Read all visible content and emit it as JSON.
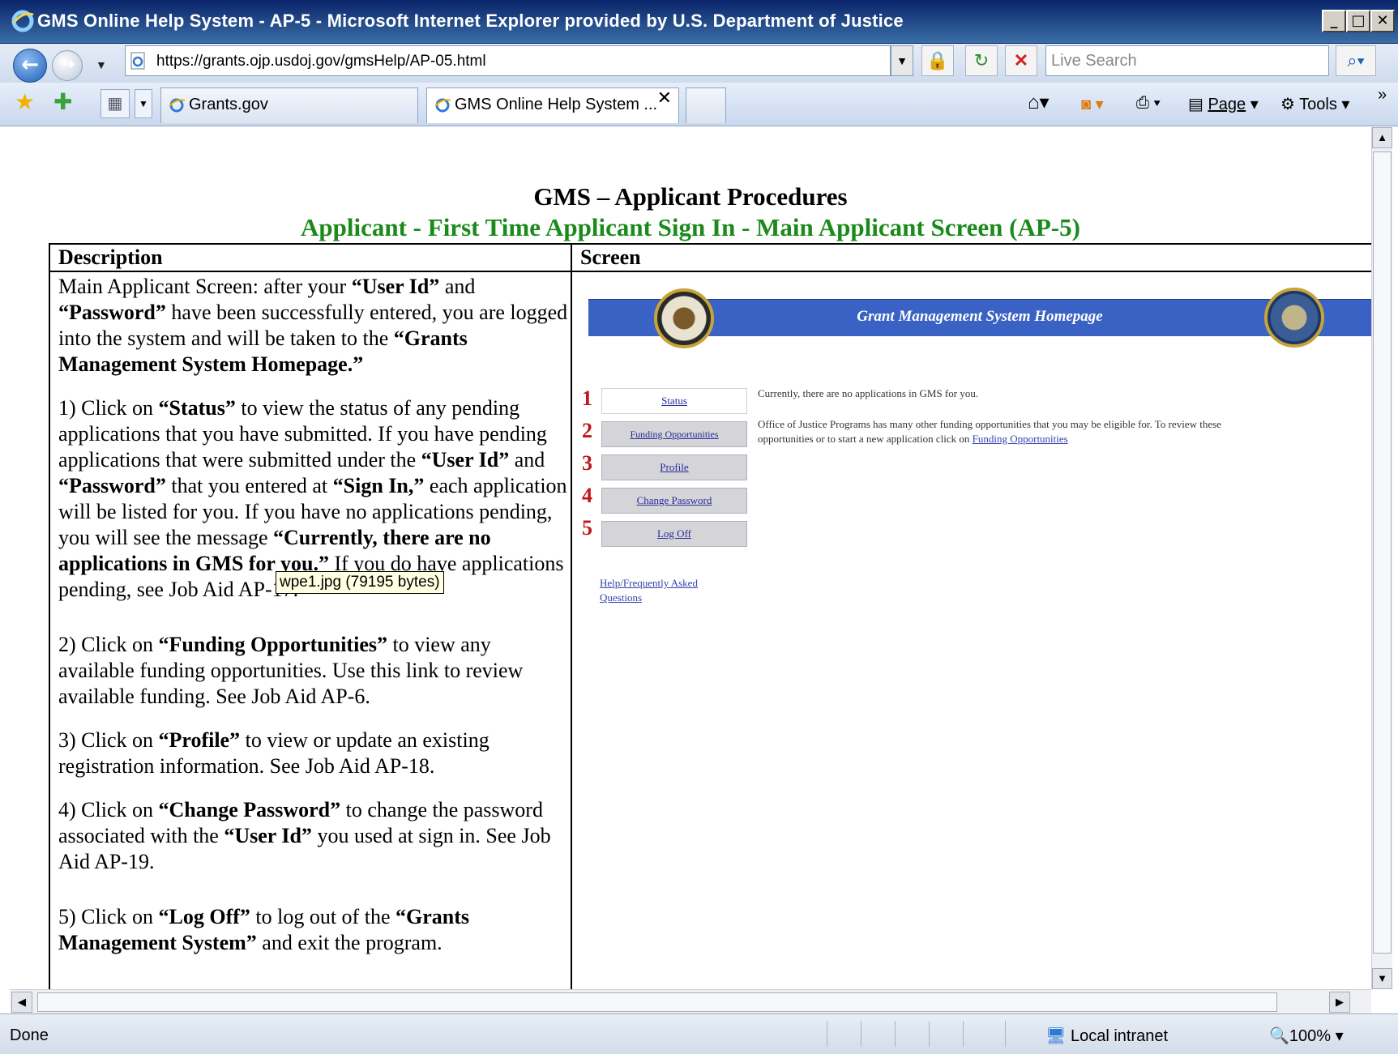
{
  "window": {
    "title": "GMS Online Help System - AP-5 - Microsoft Internet Explorer provided by U.S. Department of Justice",
    "controls": [
      "_",
      "□",
      "✕"
    ]
  },
  "address_bar": {
    "url": "https://grants.ojp.usdoj.gov/gmsHelp/AP-05.html",
    "search_placeholder": "Live Search"
  },
  "tabs": [
    {
      "label": "Grants.gov",
      "active": false
    },
    {
      "label": "GMS Online Help System ...",
      "active": true
    }
  ],
  "command_bar": {
    "page_label": "Page",
    "tools_label": "Tools",
    "overflow": "»"
  },
  "document": {
    "title": "GMS – Applicant Procedures",
    "subtitle": "Applicant - First Time Applicant Sign In - Main Applicant Screen  (AP-5)",
    "col_description": "Description",
    "col_screen": "Screen",
    "tooltip": "wpe1.jpg (79195 bytes)"
  },
  "gms_screen": {
    "banner_title": "Grant Management System Homepage",
    "buttons": [
      "Status",
      "Funding Opportunities",
      "Profile",
      "Change Password",
      "Log Off"
    ],
    "step_numbers": [
      "1",
      "2",
      "3",
      "4",
      "5"
    ],
    "message1": "Currently, there are no applications in GMS for you.",
    "message2": "Office of Justice Programs has many other funding opportunities that you may be eligible for. To review these",
    "message3_prefix": "opportunities or to start a new application click on ",
    "message3_link": "Funding Opportunities",
    "help_link_line1": "Help/Frequently Asked",
    "help_link_line2": "Questions"
  },
  "status_bar": {
    "status": "Done",
    "zone": "Local intranet",
    "zoom": "100%"
  },
  "colors": {
    "subtitle_green": "#1a8a1a",
    "step_red": "#c0151b",
    "banner_blue": "#3a62c4"
  }
}
